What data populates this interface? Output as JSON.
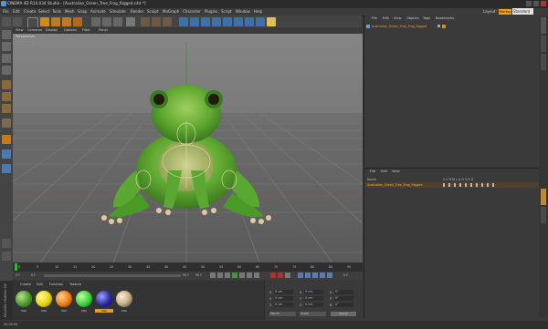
{
  "window": {
    "title": "CINEMA 4D R14.034 Studio - [Australian_Green_Tree_Frog_Rigged.c4d *]"
  },
  "menu": {
    "items": [
      "File",
      "Edit",
      "Create",
      "Select",
      "Tools",
      "Mesh",
      "Snap",
      "Animate",
      "Simulate",
      "Render",
      "Sculpt",
      "MoGraph",
      "Character",
      "Plugins",
      "Script",
      "Window",
      "Help"
    ],
    "layout_label": "Layout:",
    "layout_tag": "Startup",
    "layout_value": "Standard"
  },
  "viewport": {
    "menu": [
      "View",
      "Cameras",
      "Display",
      "Options",
      "Filter",
      "Panel"
    ],
    "label": "Perspective"
  },
  "timeline": {
    "ticks": [
      "0",
      "5",
      "10",
      "15",
      "20",
      "25",
      "30",
      "35",
      "40",
      "45",
      "50",
      "55",
      "60",
      "65",
      "70",
      "75",
      "80",
      "85",
      "90"
    ],
    "frame_start": "0 F",
    "frame_current": "0 F",
    "frame_end": "90 F",
    "frame_max": "90 F",
    "frame_indicator": "0 F"
  },
  "materials": {
    "menu": [
      "Create",
      "Edit",
      "Function",
      "Texture"
    ],
    "items": [
      {
        "label": "Mat",
        "color": "#4a9a2a"
      },
      {
        "label": "Mat",
        "color": "#e8d400"
      },
      {
        "label": "Mat",
        "color": "#f07a10"
      },
      {
        "label": "Mat",
        "color": "#3bd03b"
      },
      {
        "label": "Mat",
        "color": "#2a2aa0"
      },
      {
        "label": "Mat",
        "color": "#c8b088"
      }
    ]
  },
  "coordinates": {
    "rows": [
      {
        "a": "X",
        "av": "0 cm",
        "b": "X",
        "bv": "0 cm",
        "c": "H",
        "cv": "0°"
      },
      {
        "a": "Y",
        "av": "0 cm",
        "b": "Y",
        "bv": "0 cm",
        "c": "P",
        "cv": "0°"
      },
      {
        "a": "Z",
        "av": "0 cm",
        "b": "Z",
        "bv": "0 cm",
        "c": "B",
        "cv": "0°"
      }
    ],
    "mode_select": "World",
    "scale_select": "Scale",
    "apply_label": "Apply"
  },
  "object_manager": {
    "menu": [
      "File",
      "Edit",
      "View",
      "Objects",
      "Tags",
      "Bookmarks"
    ],
    "objects": [
      "Australian_Green_Tree_Frog_Rigged"
    ]
  },
  "attribute_manager": {
    "menu": [
      "File",
      "Edit",
      "View"
    ],
    "header_name": "Name",
    "header_cols": "S V R M L A G D E X",
    "objects": [
      "Australian_Green_Tree_Frog_Rigged"
    ]
  },
  "status": {
    "text": "00:00:00"
  },
  "brand": {
    "text": "MAXON CINEMA 4D"
  }
}
